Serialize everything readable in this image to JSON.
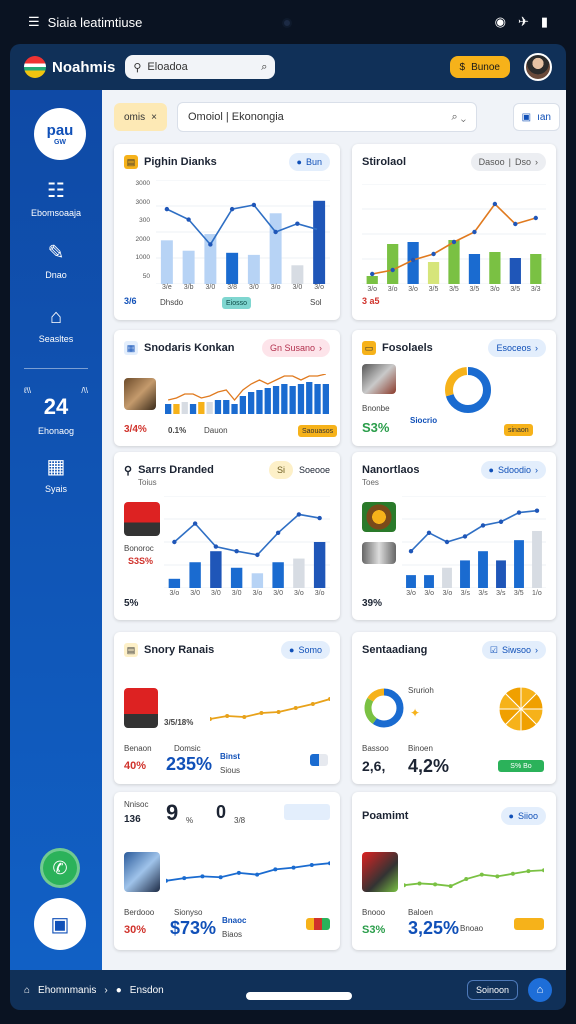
{
  "status": {
    "title": "Siaia leatimtiuse",
    "icons": [
      "◉",
      "✈",
      "▮"
    ]
  },
  "header": {
    "app_name": "Noahmis",
    "search_value": "Eloadoa",
    "coins_label": "Bunoe",
    "coin_symbol": "$"
  },
  "sidebar": {
    "logo_text": "pau",
    "logo_sub": "GW",
    "items": [
      {
        "label": "Ebomsoaaja",
        "icon": "list-icon"
      },
      {
        "label": "Dnao",
        "icon": "pen-icon"
      },
      {
        "label": "Seasltes",
        "icon": "bell-icon"
      },
      {
        "label": "Ehonaog",
        "value": "24"
      },
      {
        "label": "Syais",
        "icon": "calendar-icon"
      }
    ],
    "sep_left": "ℓ\\\\",
    "sep_right": "/\\\\",
    "fab_phone": "✆",
    "fab_chat": "▣"
  },
  "topbar": {
    "chip_label": "omis",
    "chip_close": "×",
    "search_value": "Omoiol | Ekonongia",
    "search_arrow": "⌄",
    "view_label": "ıan"
  },
  "cards": {
    "c1": {
      "title": "Pighin Dianks",
      "pill": "Bun",
      "ylabels": [
        "3000",
        "3000",
        "300",
        "2000",
        "1000",
        "50"
      ],
      "xlabels": [
        "3/e",
        "3/b",
        "3/0",
        "3/8",
        "3/0",
        "3/o",
        "3/0",
        "3/o"
      ],
      "foot_left": "3/6",
      "foot_mid": "Dhsdo",
      "foot_tag": "Eiosso",
      "foot_right": "Sol",
      "chart_line": [
        72,
        62,
        38,
        72,
        76,
        50,
        58,
        52
      ],
      "bars": [
        42,
        32,
        48,
        30,
        28,
        68,
        18,
        80
      ],
      "bar_colors": [
        "#b7d3f5",
        "#b7d3f5",
        "#b7d3f5",
        "#1a6bd0",
        "#b7d3f5",
        "#b7d3f5",
        "#d7dce3",
        "#1f56b8"
      ]
    },
    "c2": {
      "title": "Stirolaol",
      "pill1": "Dasoo",
      "pill2": "Dso",
      "foot_left": "3 a5",
      "xlabels": [
        "3/o",
        "3/o",
        "3/o",
        "3/5",
        "3/5",
        "3/5",
        "3/o",
        "3/5",
        "3/3"
      ],
      "bars": [
        8,
        40,
        42,
        22,
        44,
        30,
        32,
        26,
        30
      ],
      "bar_colors": [
        "#7ac143",
        "#7ac143",
        "#1a6bd0",
        "#d6e57a",
        "#7ac143",
        "#1a6bd0",
        "#7ac143",
        "#1f56b8",
        "#7ac143"
      ],
      "chart_line": [
        10,
        14,
        24,
        30,
        42,
        52,
        80,
        60,
        66
      ]
    },
    "c3": {
      "title": "Snodaris Konkan",
      "pill": "Gn Susano",
      "val": "3/4%",
      "mini": "0.1%",
      "foot_label": "Dauon",
      "caption": "Saouasos",
      "bars": [
        10,
        10,
        12,
        10,
        12,
        12,
        14,
        14,
        10,
        18,
        22,
        24,
        26,
        28,
        30,
        28,
        30,
        32,
        30,
        30
      ]
    },
    "c4": {
      "title": "Fosolaels",
      "pill": "Esoceos",
      "lbl1": "Bnonbe",
      "lbl2": "Siocrio",
      "val": "S3%",
      "lbl3": "sinaon"
    },
    "c5": {
      "title": "Sarrs Dranded",
      "pill": "Si",
      "pill2": "Soeooe",
      "sub": "Toius",
      "lbl": "Bonoroc",
      "val": "S3S%",
      "foot": "5%",
      "xlabels": [
        "3/o",
        "3/0",
        "3/0",
        "3/0",
        "3/o",
        "3/0",
        "3/o",
        "3/o"
      ],
      "bars": [
        10,
        28,
        40,
        22,
        16,
        28,
        32,
        50
      ],
      "bar_colors": [
        "#1a6bd0",
        "#1a6bd0",
        "#1f56b8",
        "#1a6bd0",
        "#b7d3f5",
        "#1a6bd0",
        "#d7dce3",
        "#1f56b8"
      ],
      "chart_line": [
        50,
        70,
        45,
        40,
        36,
        60,
        80,
        76
      ]
    },
    "c6": {
      "title": "Nanortlaos",
      "pill": "Sdoodio",
      "sub": "Toes",
      "val": "39%",
      "xlabels": [
        "3/o",
        "3/o",
        "3/o",
        "3/s",
        "3/s",
        "3/s",
        "3/5",
        "1/o"
      ],
      "bars": [
        14,
        14,
        22,
        30,
        40,
        30,
        52,
        62
      ],
      "bar_colors": [
        "#1a6bd0",
        "#1a6bd0",
        "#d7dce3",
        "#1a6bd0",
        "#1a6bd0",
        "#1f56b8",
        "#1a6bd0",
        "#d7dce3"
      ],
      "chart_line": [
        40,
        60,
        50,
        56,
        68,
        72,
        82,
        84
      ]
    },
    "c7": {
      "title": "Snory Ranais",
      "pill": "Somo",
      "lbl1": "Benaon",
      "lbl2": "Domsic",
      "val1": "40%",
      "val2": "235%",
      "val3": "Binst",
      "val4": "Sious",
      "line": [
        30,
        36,
        34,
        42,
        44,
        52,
        60,
        70
      ],
      "mini": "3/5/18%"
    },
    "c8": {
      "title": "Sentaadiang",
      "pill": "Siwsoo",
      "lbl": "Srurioh",
      "lbl2": "Bassoo",
      "lbl3": "Binoen",
      "val1": "2,6,",
      "val2": "4,2%",
      "tag": "S% Bo"
    },
    "c9": {
      "title": "",
      "pill": "",
      "big": "9",
      "unit": "%",
      "big2": "0",
      "lbl": "Nnisoc",
      "val": "136",
      "val2": "3/8",
      "lbl2": "Berdooo",
      "lbl3": "Sionyso",
      "val3": "30%",
      "val4": "$73%",
      "val5": "Bnaoc",
      "val6": "Biaos",
      "line": [
        30,
        36,
        40,
        38,
        48,
        44,
        56,
        60,
        66,
        70
      ]
    },
    "c10": {
      "title": "Poamimt",
      "pill": "Siioo",
      "lbl1": "Bnooo",
      "lbl2": "Baloen",
      "val1": "S3%",
      "val2": "3,25%",
      "val3": "Bnoao",
      "line": [
        20,
        24,
        22,
        18,
        34,
        44,
        40,
        46,
        52,
        54
      ]
    }
  },
  "bottom": {
    "home_label": "Ehomnmanis",
    "chev": "›",
    "section": "Ensdon",
    "status_pill": "Soinoon",
    "action": "⌂"
  },
  "colors": {
    "primary": "#1050b8",
    "accent": "#f6b21a",
    "green": "#2bb25a",
    "red": "#d0322b"
  }
}
